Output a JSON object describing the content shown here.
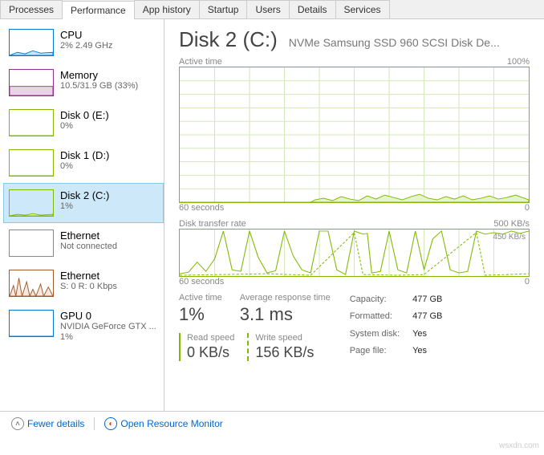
{
  "tabs": [
    "Processes",
    "Performance",
    "App history",
    "Startup",
    "Users",
    "Details",
    "Services"
  ],
  "active_tab": 1,
  "sidebar": [
    {
      "title": "CPU",
      "sub": "2% 2.49 GHz",
      "accent": "#0078d7",
      "fill": "#cce4f7",
      "selected": false
    },
    {
      "title": "Memory",
      "sub": "10.5/31.9 GB (33%)",
      "accent": "#9b2d8e",
      "fill": "#e8d4e6",
      "selected": false
    },
    {
      "title": "Disk 0 (E:)",
      "sub": "0%",
      "accent": "#7fba00",
      "fill": "#e5f3cf",
      "selected": false
    },
    {
      "title": "Disk 1 (D:)",
      "sub": "0%",
      "accent": "#7fba00",
      "fill": "#e5f3cf",
      "selected": false
    },
    {
      "title": "Disk 2 (C:)",
      "sub": "1%",
      "accent": "#7fba00",
      "fill": "#e5f3cf",
      "selected": true
    },
    {
      "title": "Ethernet",
      "sub": "Not connected",
      "accent": "#888888",
      "fill": "#ffffff",
      "selected": false
    },
    {
      "title": "Ethernet",
      "sub": "S: 0 R: 0 Kbps",
      "accent": "#a05a2c",
      "fill": "#f7e7dd",
      "selected": false
    },
    {
      "title": "GPU 0",
      "sub": "NVIDIA GeForce GTX ...\n1%",
      "accent": "#0078d7",
      "fill": "#cce4f7",
      "selected": false
    }
  ],
  "header": {
    "title": "Disk 2 (C:)",
    "subtitle": "NVMe Samsung SSD 960 SCSI Disk De..."
  },
  "graph1": {
    "label": "Active time",
    "max": "100%",
    "x_left": "60 seconds",
    "x_right": "0"
  },
  "graph2": {
    "label": "Disk transfer rate",
    "max": "500 KB/s",
    "inner": "450 KB/s",
    "x_left": "60 seconds",
    "x_right": "0"
  },
  "stats": {
    "active_time_l": "Active time",
    "active_time_v": "1%",
    "avg_resp_l": "Average response time",
    "avg_resp_v": "3.1 ms",
    "read_l": "Read speed",
    "read_v": "0 KB/s",
    "write_l": "Write speed",
    "write_v": "156 KB/s"
  },
  "kv": [
    {
      "k": "Capacity:",
      "v": "477 GB"
    },
    {
      "k": "Formatted:",
      "v": "477 GB"
    },
    {
      "k": "System disk:",
      "v": "Yes"
    },
    {
      "k": "Page file:",
      "v": "Yes"
    }
  ],
  "footer": {
    "fewer": "Fewer details",
    "open": "Open Resource Monitor"
  },
  "watermark": "wsxdn.com",
  "chart_data": [
    {
      "type": "line",
      "title": "Active time",
      "ylabel": "%",
      "ylim": [
        0,
        100
      ],
      "x": "60..0 seconds",
      "values": [
        0,
        0,
        0,
        0,
        0,
        0,
        0,
        0,
        0,
        0,
        0,
        0,
        0,
        0,
        0,
        0,
        0,
        0,
        0,
        0,
        0,
        0,
        2,
        3,
        1,
        2,
        4,
        3,
        2,
        1,
        4,
        2,
        5,
        3,
        2,
        1,
        3,
        5,
        4,
        2,
        3,
        2,
        1,
        3,
        2,
        4,
        2,
        3,
        2,
        1,
        2,
        3,
        2,
        1,
        2,
        3,
        2,
        4,
        3,
        2
      ]
    },
    {
      "type": "line",
      "title": "Disk transfer rate",
      "ylabel": "KB/s",
      "ylim": [
        0,
        500
      ],
      "x": "60..0 seconds",
      "series": [
        {
          "name": "transfer",
          "values": [
            20,
            30,
            120,
            40,
            150,
            480,
            60,
            40,
            480,
            200,
            30,
            50,
            480,
            200,
            50,
            30,
            480,
            480,
            50,
            20,
            480,
            470,
            450,
            460,
            30,
            40,
            480,
            60,
            30,
            480,
            50,
            400,
            480,
            60,
            30,
            40,
            480,
            450,
            470,
            450
          ]
        }
      ]
    }
  ]
}
